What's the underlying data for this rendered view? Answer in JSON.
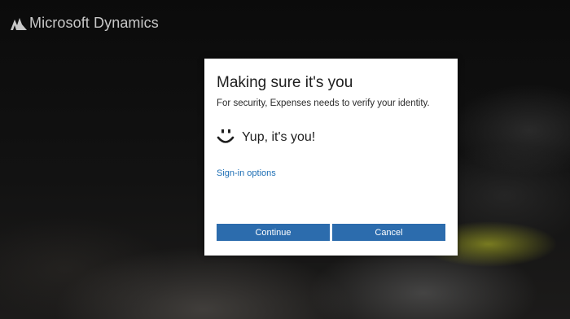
{
  "branding": {
    "product_name": "Microsoft Dynamics",
    "logo_icon": "dynamics-logo-icon"
  },
  "dialog": {
    "title": "Making sure it's you",
    "subtitle": "For security, Expenses needs to verify your identity.",
    "status_icon": "smiley-icon",
    "status_text": "Yup, it's you!",
    "signin_options_label": "Sign-in options",
    "continue_label": "Continue",
    "cancel_label": "Cancel"
  },
  "colors": {
    "button": "#2c6cad",
    "link": "#1e6fb5",
    "dialog_bg": "#ffffff",
    "backdrop": "#0b0b0b"
  }
}
